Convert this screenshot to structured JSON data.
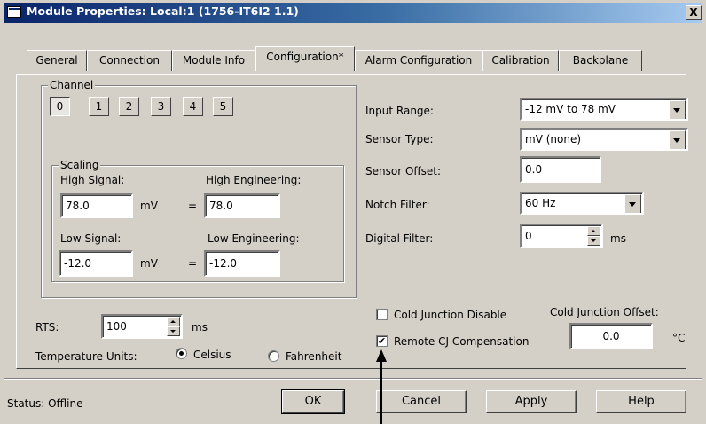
{
  "window": {
    "title": "Module Properties: Local:1 (1756-IT6I2 1.1)",
    "close_label": "X"
  },
  "tabs": [
    {
      "label": "General"
    },
    {
      "label": "Connection"
    },
    {
      "label": "Module Info"
    },
    {
      "label": "Configuration*"
    },
    {
      "label": "Alarm Configuration"
    },
    {
      "label": "Calibration"
    },
    {
      "label": "Backplane"
    }
  ],
  "channel": {
    "label": "Channel",
    "buttons": [
      "0",
      "1",
      "2",
      "3",
      "4",
      "5"
    ],
    "selected": "0"
  },
  "scaling": {
    "label": "Scaling",
    "high_signal_label": "High Signal:",
    "high_signal_value": "78.0",
    "high_engineering_label": "High Engineering:",
    "high_engineering_value": "78.0",
    "low_signal_label": "Low Signal:",
    "low_signal_value": "-12.0",
    "low_engineering_label": "Low Engineering:",
    "low_engineering_value": "-12.0",
    "unit": "mV",
    "equals": "="
  },
  "settings": {
    "input_range_label": "Input Range:",
    "input_range_value": "-12 mV to 78 mV",
    "sensor_type_label": "Sensor Type:",
    "sensor_type_value": "mV (none)",
    "sensor_offset_label": "Sensor Offset:",
    "sensor_offset_value": "0.0",
    "notch_filter_label": "Notch Filter:",
    "notch_filter_value": "60 Hz",
    "digital_filter_label": "Digital Filter:",
    "digital_filter_value": "0",
    "digital_filter_unit": "ms"
  },
  "rts": {
    "label": "RTS:",
    "value": "100",
    "unit": "ms"
  },
  "temperature_units": {
    "label": "Temperature Units:",
    "celsius": "Celsius",
    "fahrenheit": "Fahrenheit",
    "selected": "Celsius"
  },
  "cold_junction": {
    "disable_label": "Cold Junction Disable",
    "disable_checked": false,
    "remote_label": "Remote CJ Compensation",
    "remote_checked": true,
    "offset_label": "Cold Junction Offset:",
    "offset_value": "0.0",
    "offset_unit": "°C",
    "check_glyph": "✔"
  },
  "status": {
    "text": "Status:  Offline"
  },
  "buttons": {
    "ok": "OK",
    "cancel": "Cancel",
    "apply": "Apply",
    "help": "Help"
  },
  "colors": {
    "title_bar": "#0a246a",
    "dialog_face": "#d4d0c8"
  }
}
